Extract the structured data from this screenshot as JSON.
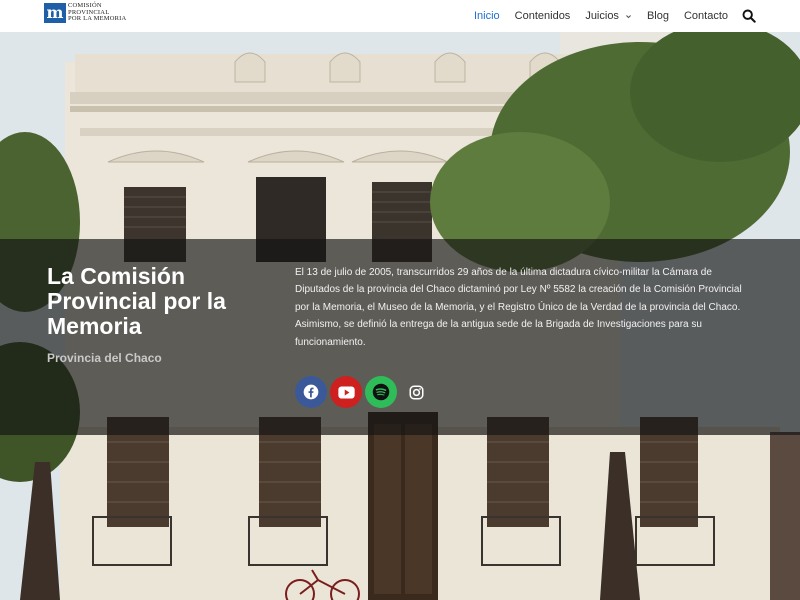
{
  "header": {
    "logo": {
      "mark": "m",
      "lines": [
        "COMISIÓN",
        "PROVINCIAL",
        "POR LA MEMORIA"
      ]
    },
    "nav": [
      {
        "label": "Inicio",
        "active": true
      },
      {
        "label": "Contenidos"
      },
      {
        "label": "Juicios",
        "has_dropdown": true
      },
      {
        "label": "Blog"
      },
      {
        "label": "Contacto"
      }
    ]
  },
  "hero": {
    "title": "La Comisión Provincial por la Memoria",
    "subtitle": "Provincia del Chaco",
    "description": "El 13 de julio de 2005, transcurridos 29 años de la última dictadura cívico-militar la Cámara de Diputados de la provincia del Chaco dictaminó por Ley Nº 5582 la creación de la Comisión Provincial por la Memoria, el Museo de la Memoria, y el Registro Único de la Verdad de la provincia del Chaco. Asimismo, se definió la entrega de la antigua sede de la Brigada de Investigaciones para su funcionamiento."
  },
  "social": [
    {
      "icon": "facebook-icon",
      "color": "#3b5998"
    },
    {
      "icon": "youtube-icon",
      "color": "#cd201f"
    },
    {
      "icon": "spotify-icon",
      "color": "#2ebd59"
    },
    {
      "icon": "instagram-icon",
      "color": "#ffffff"
    }
  ],
  "colors": {
    "accent": "#1d6fd1",
    "logo": "#1f5fa8"
  }
}
